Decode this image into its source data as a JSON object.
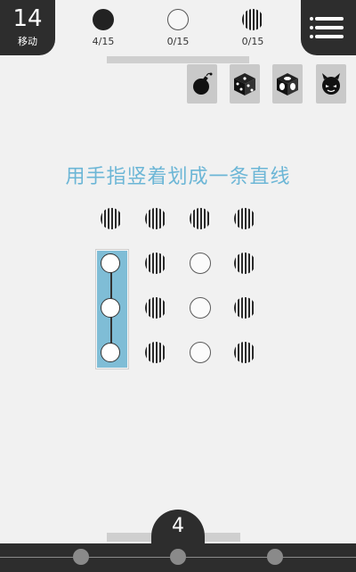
{
  "moves": {
    "count": "14",
    "label": "移动"
  },
  "counters": [
    {
      "type": "black",
      "value": "4/15"
    },
    {
      "type": "white",
      "value": "0/15"
    },
    {
      "type": "striped",
      "value": "0/15"
    }
  ],
  "tools": [
    "bomb-icon",
    "dice-icon",
    "cube-icon",
    "demon-icon"
  ],
  "instruction": "用手指竖着划成一条直线",
  "grid": {
    "rows": [
      [
        "striped",
        "striped",
        "striped",
        "striped"
      ],
      [
        "white",
        "striped",
        "white",
        "striped"
      ],
      [
        "white",
        "striped",
        "white",
        "striped"
      ],
      [
        "white",
        "striped",
        "white",
        "striped"
      ]
    ]
  },
  "level": "4",
  "menu_icon": "menu-icon",
  "colors": {
    "accent": "#7fbdd6",
    "dark": "#2d2d2d",
    "background": "#f1f1f1"
  }
}
